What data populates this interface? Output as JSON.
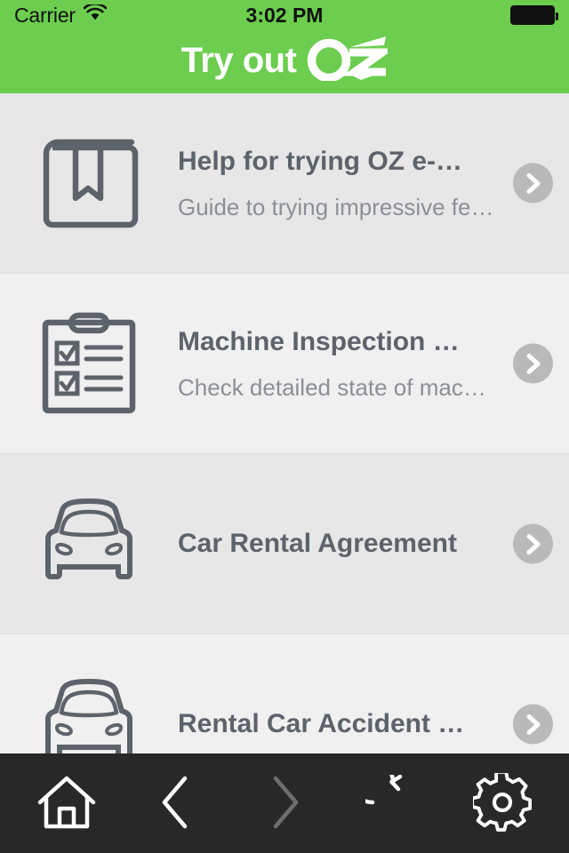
{
  "status_bar": {
    "carrier": "Carrier",
    "wifi_icon": "wifi-icon",
    "time": "3:02 PM",
    "battery_icon": "battery-full-icon"
  },
  "header": {
    "title_prefix": "Try out",
    "logo_mark": "Oz",
    "background_color": "#6ccd4e",
    "text_color": "#ffffff"
  },
  "list": {
    "items": [
      {
        "icon": "book-bookmark-icon",
        "title": "Help for trying OZ e-…",
        "subtitle": "Guide to trying impressive fe…",
        "chevron": "chevron-right-icon"
      },
      {
        "icon": "clipboard-checklist-icon",
        "title": "Machine Inspection …",
        "subtitle": "Check detailed state of mac…",
        "chevron": "chevron-right-icon"
      },
      {
        "icon": "car-front-icon",
        "title": "Car Rental Agreement",
        "subtitle": "",
        "chevron": "chevron-right-icon"
      },
      {
        "icon": "car-front-icon",
        "title": "Rental Car Accident …",
        "subtitle": "",
        "chevron": "chevron-right-icon"
      }
    ],
    "title_color": "#5d636b",
    "subtitle_color": "#8b9097",
    "chevron_bg_color": "#b9b9b9"
  },
  "toolbar": {
    "background_color": "#282828",
    "buttons": [
      {
        "name": "home",
        "icon": "home-icon",
        "state": "enabled"
      },
      {
        "name": "back",
        "icon": "chevron-left-icon",
        "state": "enabled"
      },
      {
        "name": "forward",
        "icon": "chevron-right-icon",
        "state": "disabled"
      },
      {
        "name": "reload",
        "icon": "refresh-icon",
        "state": "enabled"
      },
      {
        "name": "settings",
        "icon": "gear-icon",
        "state": "enabled"
      }
    ]
  }
}
